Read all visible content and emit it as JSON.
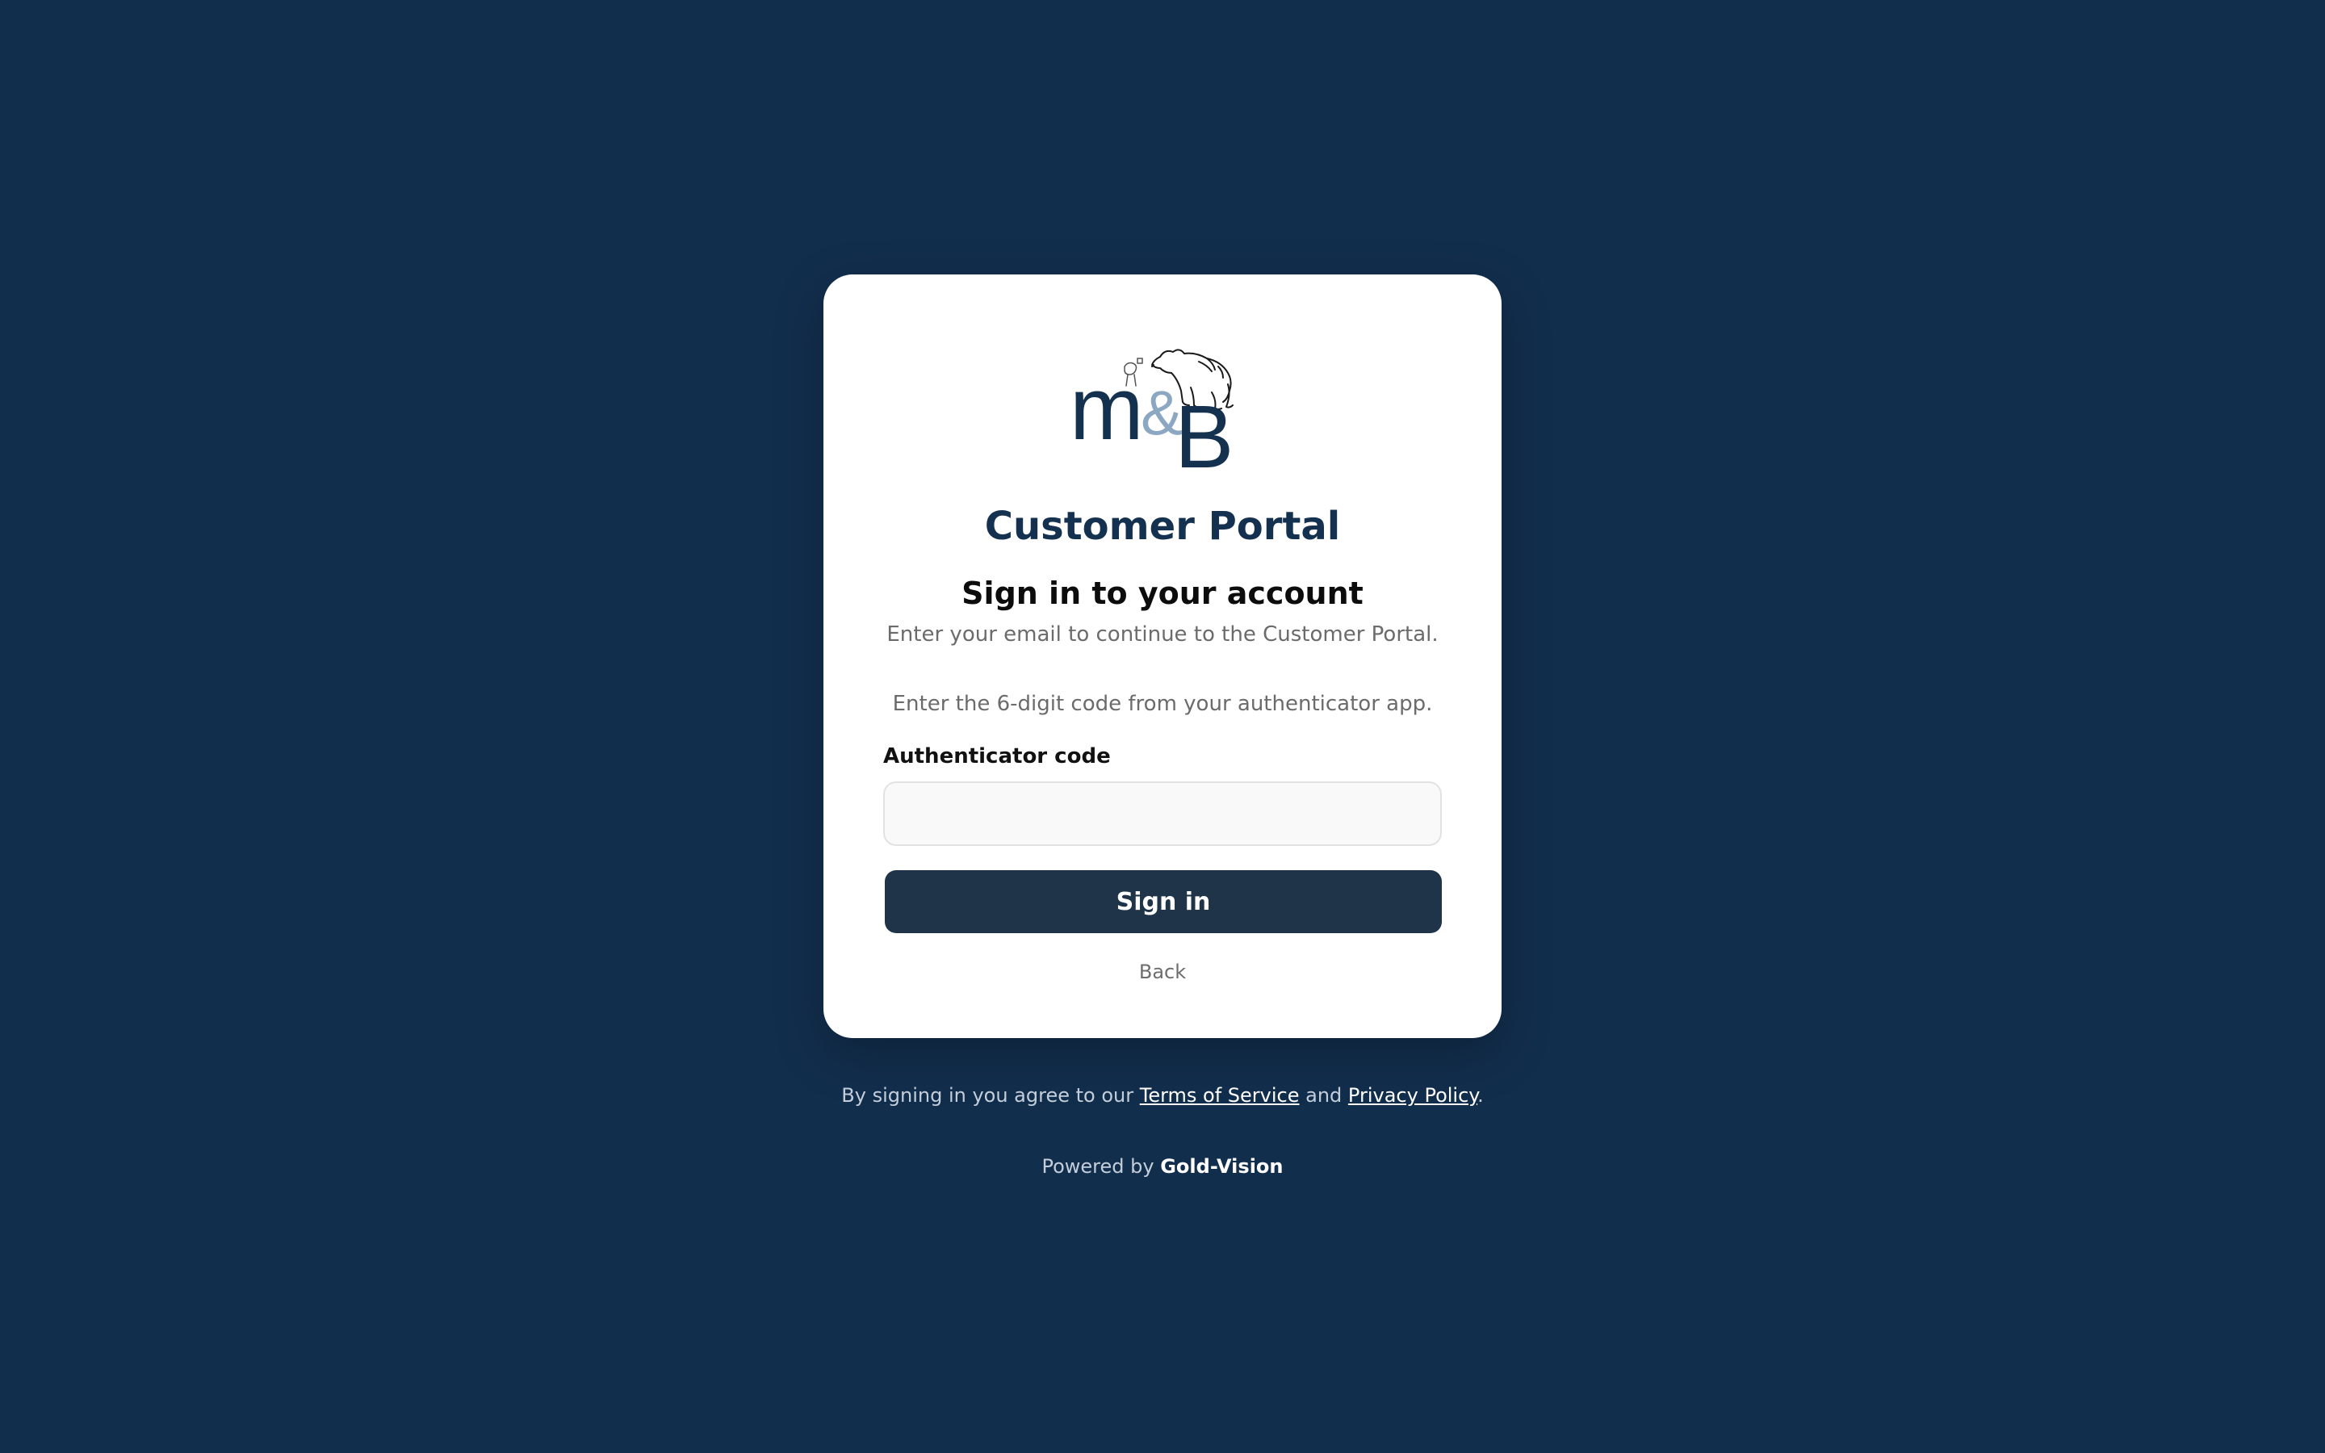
{
  "brand": {
    "logo_icon": "mb-bears-logo",
    "logo_letters": {
      "m": "m",
      "amp": "&",
      "b": "B"
    },
    "primary_color": "#143150",
    "background_color": "#122e4d"
  },
  "card": {
    "portal_title": "Customer Portal",
    "heading": "Sign in to your account",
    "subtitle": "Enter your email to continue to the Customer Portal.",
    "hint": "Enter the 6-digit code from your authenticator app.",
    "code_label": "Authenticator code",
    "code_value": "",
    "code_placeholder": "",
    "sign_in_label": "Sign in",
    "back_label": "Back"
  },
  "footer": {
    "legal_prefix": "By signing in you agree to our ",
    "terms_label": "Terms of Service",
    "legal_and": " and ",
    "privacy_label": "Privacy Policy",
    "legal_suffix": ".",
    "powered_prefix": "Powered by ",
    "powered_brand": "Gold-Vision"
  }
}
